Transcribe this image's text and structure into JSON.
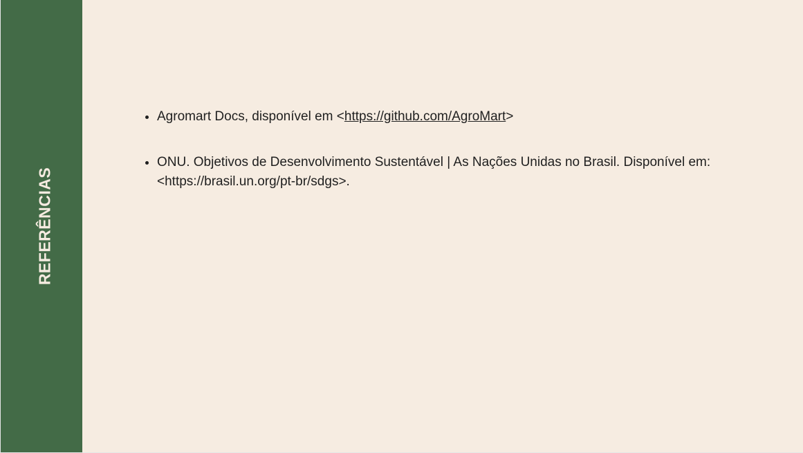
{
  "sidebar": {
    "title": "REFERÊNCIAS"
  },
  "references": [
    {
      "prefix": "Agromart Docs, disponível em <",
      "link": "https://github.com/AgroMart",
      "suffix": ">"
    },
    {
      "text": "ONU. Objetivos de Desenvolvimento Sustentável | As Nações Unidas no Brasil. Disponível em: <https://brasil.un.org/pt-br/sdgs>."
    }
  ],
  "colors": {
    "sidebar": "#436b47",
    "background": "#f6ece1"
  }
}
